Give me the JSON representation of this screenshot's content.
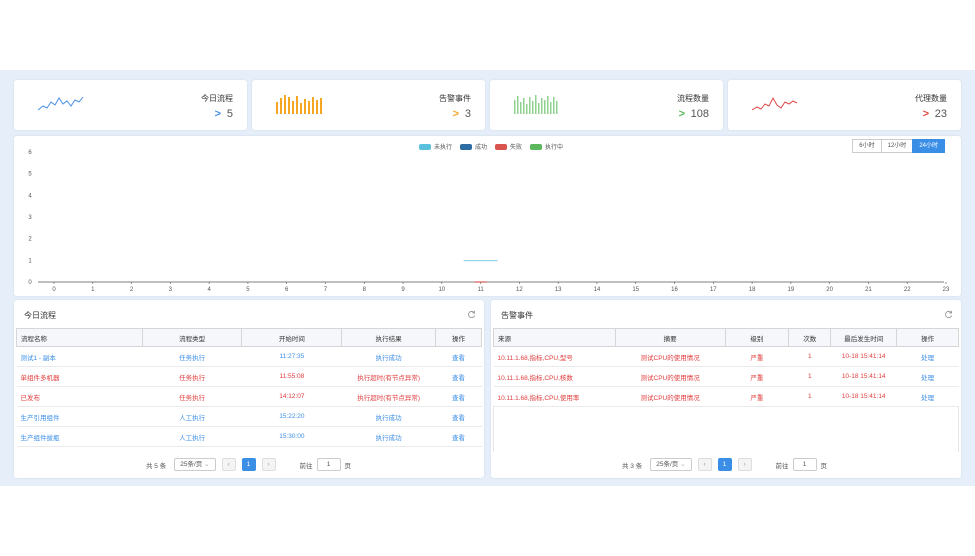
{
  "stats": [
    {
      "label": "今日流程",
      "value": "5",
      "color": "#4a90e2",
      "arrow_color": "#4a90e2"
    },
    {
      "label": "告警事件",
      "value": "3",
      "color": "#f5a623",
      "arrow_color": "#f5a623"
    },
    {
      "label": "流程数量",
      "value": "108",
      "color": "#5cb85c",
      "arrow_color": "#5cb85c"
    },
    {
      "label": "代理数量",
      "value": "23",
      "color": "#e04848",
      "arrow_color": "#e04848"
    }
  ],
  "arrow_glyph": ">",
  "time_buttons": [
    "6小时",
    "12小时",
    "24小时"
  ],
  "time_active": "24小时",
  "chart_data": {
    "type": "bar",
    "legend": [
      {
        "name": "未执行",
        "color": "#5bc0de"
      },
      {
        "name": "成功",
        "color": "#2e6da4"
      },
      {
        "name": "失败",
        "color": "#d9534f"
      },
      {
        "name": "执行中",
        "color": "#5cb85c"
      }
    ],
    "categories": [
      "0",
      "1",
      "2",
      "3",
      "4",
      "5",
      "6",
      "7",
      "8",
      "9",
      "10",
      "11",
      "12",
      "13",
      "14",
      "15",
      "16",
      "17",
      "18",
      "19",
      "20",
      "21",
      "22",
      "23"
    ],
    "series": [
      {
        "name": "未执行",
        "values": [
          0,
          0,
          0,
          0,
          0,
          0,
          0,
          0,
          0,
          0,
          0,
          1,
          0,
          0,
          0,
          0,
          0,
          0,
          0,
          0,
          0,
          0,
          0,
          0
        ]
      },
      {
        "name": "成功",
        "values": [
          0,
          0,
          0,
          0,
          0,
          0,
          0,
          0,
          0,
          0,
          0,
          0,
          0,
          0,
          0,
          0,
          0,
          0,
          0,
          0,
          0,
          0,
          0,
          0
        ]
      },
      {
        "name": "失败",
        "values": [
          0,
          0,
          0,
          0,
          0,
          0,
          0,
          0,
          0,
          0,
          0,
          0,
          0,
          0,
          0,
          0,
          0,
          0,
          0,
          0,
          0,
          0,
          0,
          0
        ]
      },
      {
        "name": "执行中",
        "values": [
          0,
          0,
          0,
          0,
          0,
          0,
          0,
          0,
          0,
          0,
          0,
          0,
          0,
          0,
          0,
          0,
          0,
          0,
          0,
          0,
          0,
          0,
          0,
          0
        ]
      }
    ],
    "y_ticks": [
      "0",
      "1",
      "2",
      "3",
      "4",
      "5",
      "6"
    ],
    "ylim": [
      0,
      6
    ]
  },
  "flow_panel": {
    "title": "今日流程",
    "columns": [
      "流程名称",
      "流程类型",
      "开始时间",
      "执行结果",
      "操作"
    ],
    "rows": [
      {
        "name": "测试1 - 副本",
        "type": "任务执行",
        "time": "11:27:35",
        "result": "执行成功",
        "action": "查看",
        "red": false
      },
      {
        "name": "单组件多机器",
        "type": "任务执行",
        "time": "11:55:08",
        "result": "执行超时(有节点异常)",
        "action": "查看",
        "red": true
      },
      {
        "name": "已发布",
        "type": "任务执行",
        "time": "14:12:07",
        "result": "执行超时(有节点异常)",
        "action": "查看",
        "red": true
      },
      {
        "name": "生产引用组件",
        "type": "人工执行",
        "time": "15:22:20",
        "result": "执行成功",
        "action": "查看",
        "red": false
      },
      {
        "name": "生产组件拔瓶",
        "type": "人工执行",
        "time": "15:30:00",
        "result": "执行成功",
        "action": "查看",
        "red": false
      }
    ],
    "pager": {
      "total": "共 5 条",
      "size": "25条/页",
      "page": "1",
      "goto": "前往",
      "goto_value": "1",
      "page_suffix": "页"
    }
  },
  "alarm_panel": {
    "title": "告警事件",
    "columns": [
      "来源",
      "摘要",
      "级别",
      "次数",
      "最后发生时间",
      "操作"
    ],
    "rows": [
      {
        "source": "10.11.1.68,指标,CPU,型号",
        "summary": "测试CPU的使用情况",
        "level": "严重",
        "count": "1",
        "time": "10-18 15:41:14",
        "action": "处理"
      },
      {
        "source": "10.11.1.68,指标,CPU,核数",
        "summary": "测试CPU的使用情况",
        "level": "严重",
        "count": "1",
        "time": "10-18 15:41:14",
        "action": "处理"
      },
      {
        "source": "10.11.1.68,指标,CPU,使用率",
        "summary": "测试CPU的使用情况",
        "level": "严重",
        "count": "1",
        "time": "10-18 15:41:14",
        "action": "处理"
      }
    ],
    "pager": {
      "total": "共 3 条",
      "size": "25条/页",
      "page": "1",
      "goto": "前往",
      "goto_value": "1",
      "page_suffix": "页"
    }
  },
  "icons": {
    "refresh": "refresh-icon",
    "prev": "‹",
    "next": "›",
    "chevron": "⌄"
  }
}
